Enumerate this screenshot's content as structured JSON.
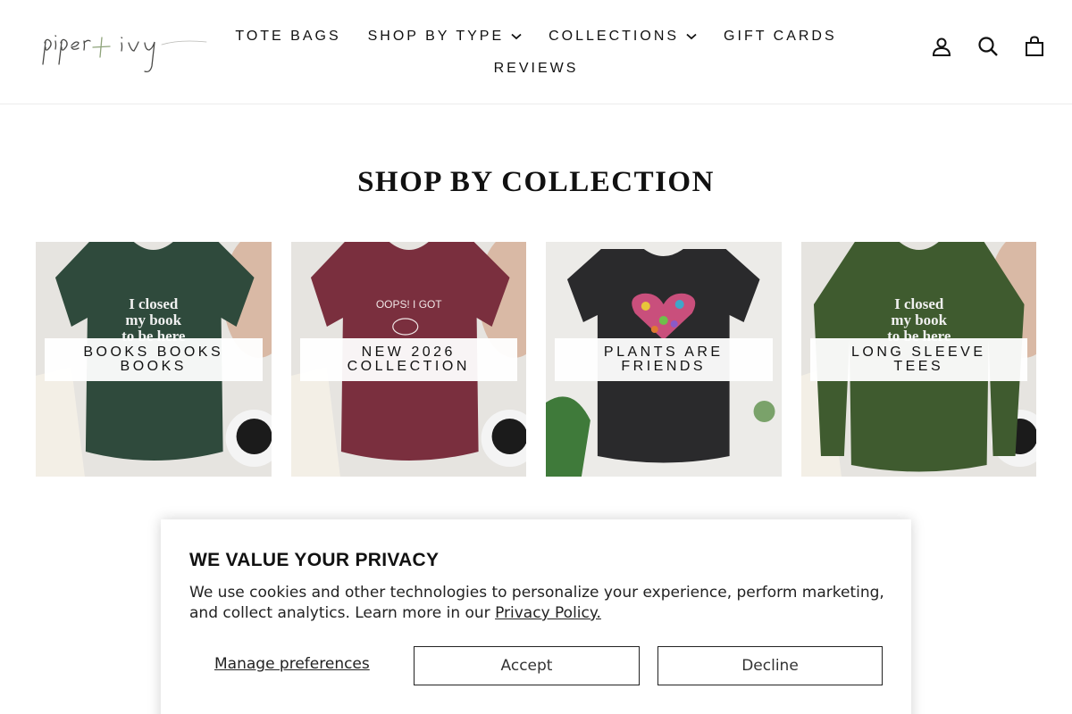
{
  "brand": {
    "logo_text": "piper+ivy"
  },
  "nav": {
    "row1": [
      {
        "label": "TOTE BAGS",
        "dropdown": false
      },
      {
        "label": "SHOP BY TYPE",
        "dropdown": true
      },
      {
        "label": "COLLECTIONS",
        "dropdown": true
      },
      {
        "label": "GIFT CARDS",
        "dropdown": false
      }
    ],
    "row2": [
      {
        "label": "REVIEWS",
        "dropdown": false
      }
    ]
  },
  "header_icons": [
    "account-icon",
    "search-icon",
    "cart-icon"
  ],
  "section": {
    "title": "SHOP BY COLLECTION"
  },
  "collections": [
    {
      "label": "BOOKS BOOKS BOOKS",
      "shirt_color": "#2f4a3c",
      "shirt_text": "I closed my book to be here"
    },
    {
      "label": "NEW 2026 COLLECTION",
      "shirt_color": "#7a2f3e",
      "shirt_text": "OOPS! I GOT"
    },
    {
      "label": "PLANTS ARE FRIENDS",
      "shirt_color": "#2a2a2c",
      "shirt_text": ""
    },
    {
      "label": "LONG SLEEVE TEES",
      "shirt_color": "#3f5b2f",
      "shirt_text": "I closed my book to be here"
    }
  ],
  "cookie": {
    "title": "WE VALUE YOUR PRIVACY",
    "text": "We use cookies and other technologies to personalize your experience, perform marketing, and collect analytics. Learn more in our",
    "link": "Privacy Policy.",
    "manage": "Manage preferences",
    "accept": "Accept",
    "decline": "Decline"
  },
  "colors": {
    "text": "#111111",
    "border": "#222222",
    "background": "#ffffff"
  }
}
